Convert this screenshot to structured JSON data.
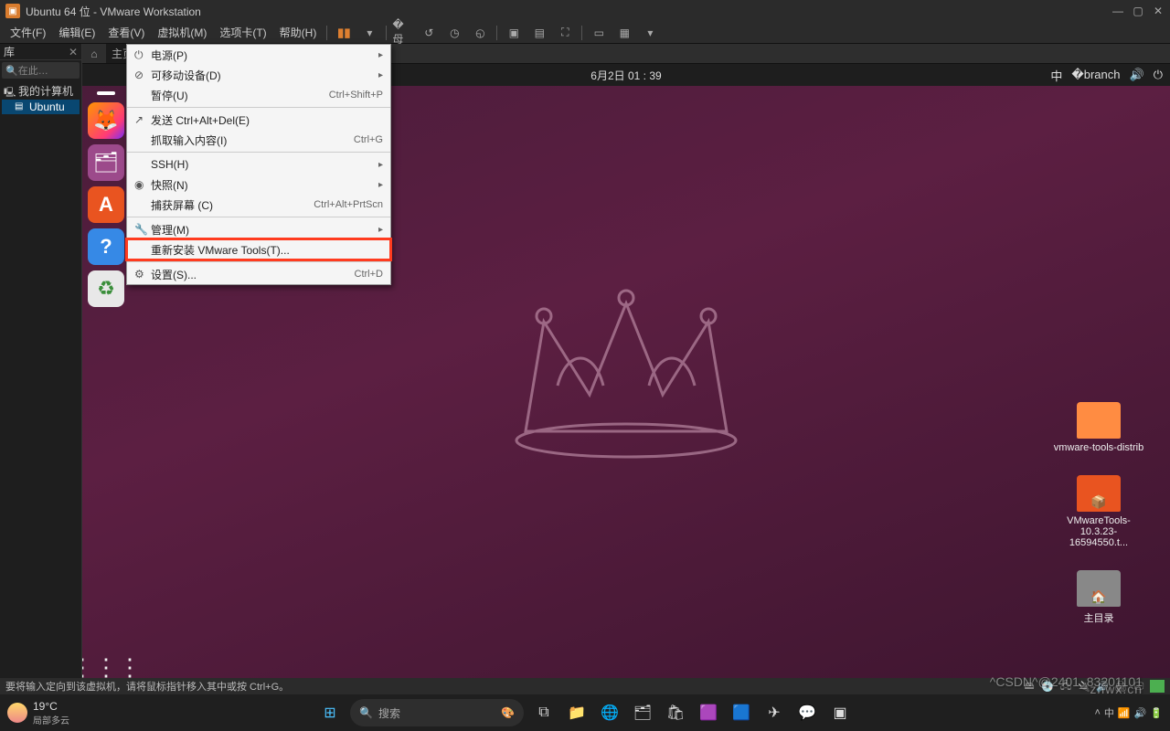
{
  "title": "Ubuntu 64 位 - VMware Workstation",
  "menu": {
    "file": "文件(F)",
    "edit": "编辑(E)",
    "view": "查看(V)",
    "vm": "虚拟机(M)",
    "tabs": "选项卡(T)",
    "help": "帮助(H)"
  },
  "sidebar": {
    "title": "库",
    "search": "在此…",
    "root": "我的计算机",
    "node": "Ubuntu"
  },
  "tab": {
    "home": "⌂",
    "vm": "主页"
  },
  "ubuntu": {
    "clock": "6月2日  01 : 39",
    "ime": "中",
    "desk": {
      "folder": "vmware-tools-distrib",
      "tar": "VMwareTools-10.3.23-16594550.t...",
      "home": "主目录"
    }
  },
  "vm_menu": {
    "power": "电源(P)",
    "removable": "可移动设备(D)",
    "pause": "暂停(U)",
    "pause_sc": "Ctrl+Shift+P",
    "send": "发送 Ctrl+Alt+Del(E)",
    "grab": "抓取输入内容(I)",
    "grab_sc": "Ctrl+G",
    "ssh": "SSH(H)",
    "snapshot": "快照(N)",
    "capture": "捕获屏幕 (C)",
    "capture_sc": "Ctrl+Alt+PrtScn",
    "manage": "管理(M)",
    "reinstall": "重新安装 VMware Tools(T)...",
    "settings": "设置(S)...",
    "settings_sc": "Ctrl+D"
  },
  "status": "要将输入定向到该虚拟机，请将鼠标指针移入其中或按 Ctrl+G。",
  "taskbar": {
    "temp": "19°C",
    "weather": "局部多云",
    "search": "搜索",
    "watermark": "^CSDN^@2401_83201101",
    "watermark2": "znwx.cn"
  }
}
